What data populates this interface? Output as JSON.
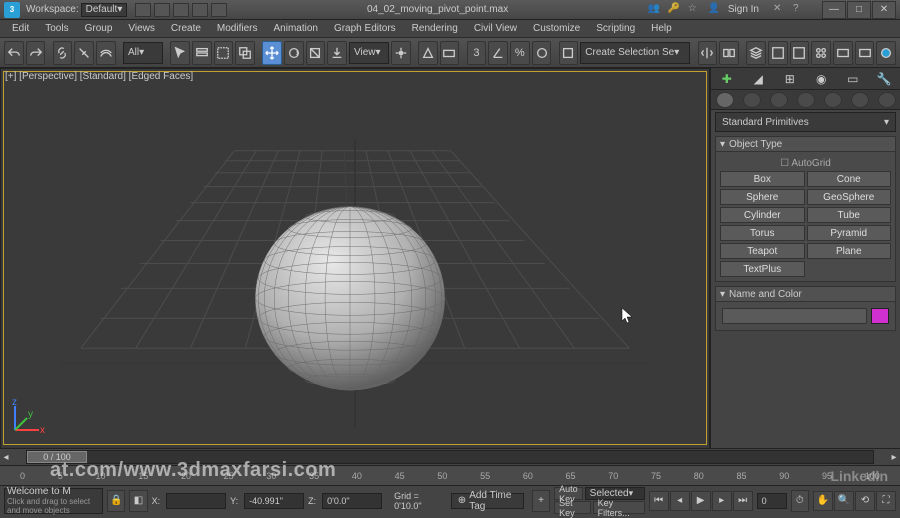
{
  "titlebar": {
    "workspace_label": "Workspace:",
    "workspace_value": "Default",
    "filename": "04_02_moving_pivot_point.max",
    "signin": "Sign In"
  },
  "menu": [
    "Edit",
    "Tools",
    "Group",
    "Views",
    "Create",
    "Modifiers",
    "Animation",
    "Graph Editors",
    "Rendering",
    "Civil View",
    "Customize",
    "Scripting",
    "Help"
  ],
  "toolbar": {
    "all": "All",
    "view": "View",
    "selset": "Create Selection Se"
  },
  "viewport": {
    "label": "[+] [Perspective] [Standard] [Edged Faces]"
  },
  "sidebar": {
    "dropdown": "Standard Primitives",
    "object_type_title": "Object Type",
    "autogrid": "AutoGrid",
    "prims": [
      "Box",
      "Cone",
      "Sphere",
      "GeoSphere",
      "Cylinder",
      "Tube",
      "Torus",
      "Pyramid",
      "Teapot",
      "Plane",
      "TextPlus",
      ""
    ],
    "name_color_title": "Name and Color"
  },
  "timeline": {
    "slider_label": "0 / 100",
    "ticks": [
      "0",
      "5",
      "10",
      "15",
      "20",
      "25",
      "30",
      "35",
      "40",
      "45",
      "50",
      "55",
      "60",
      "65",
      "70",
      "75",
      "80",
      "85",
      "90",
      "95",
      "100"
    ]
  },
  "status": {
    "welcome": "Welcome to M",
    "hint": "Click and drag to select and move objects",
    "x": "",
    "y": "-40.991\"",
    "z": "0'0.0\"",
    "grid": "Grid = 0'10.0\"",
    "addtag": "Add Time Tag",
    "autokey": "Auto Key",
    "setkey": "Set Key",
    "selected": "Selected",
    "keyfilters": "Key Filters...",
    "frame": "0"
  },
  "watermark": "at.com/www.3dmaxfarsi.com",
  "linkedin": "Linkedin"
}
